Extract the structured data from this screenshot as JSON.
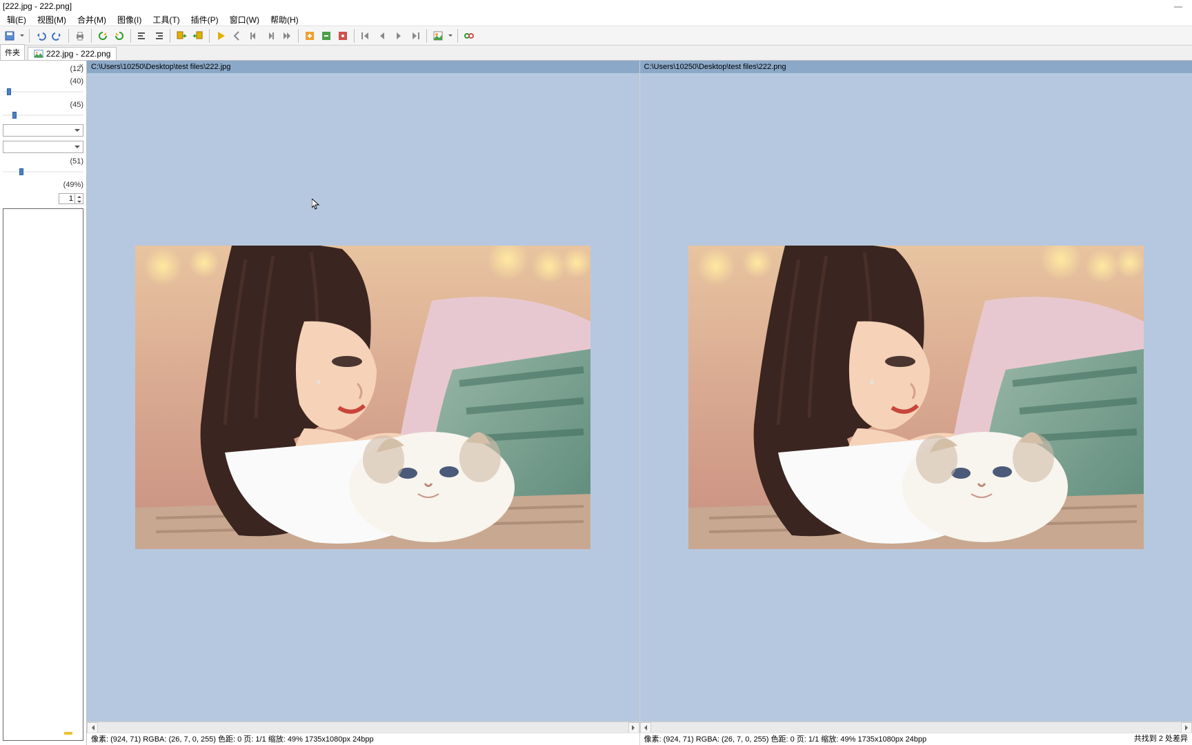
{
  "title": "[222.jpg - 222.png]",
  "menu": [
    "辑(E)",
    "视图(M)",
    "合并(M)",
    "图像(I)",
    "工具(T)",
    "插件(P)",
    "窗口(W)",
    "帮助(H)"
  ],
  "side_tab": "件夹",
  "file_tab": "222.jpg - 222.png",
  "panel": {
    "v1": "(12)",
    "v2": "(40)",
    "v3": "(45)",
    "v4": "(51)",
    "v5": "(49%)",
    "spin": "1"
  },
  "panes": [
    {
      "path": "C:\\Users\\10250\\Desktop\\test files\\222.jpg",
      "info": "像素: (924, 71)   RGBA: (26, 7, 0, 255)   色距: 0  页: 1/1  缩放: 49%   1735x1080px   24bpp"
    },
    {
      "path": "C:\\Users\\10250\\Desktop\\test files\\222.png",
      "info": "像素: (924, 71)   RGBA: (26, 7, 0, 255)   色距: 0  页: 1/1  缩放: 49%   1735x1080px   24bpp"
    }
  ],
  "status": "共找到 2 处差异"
}
